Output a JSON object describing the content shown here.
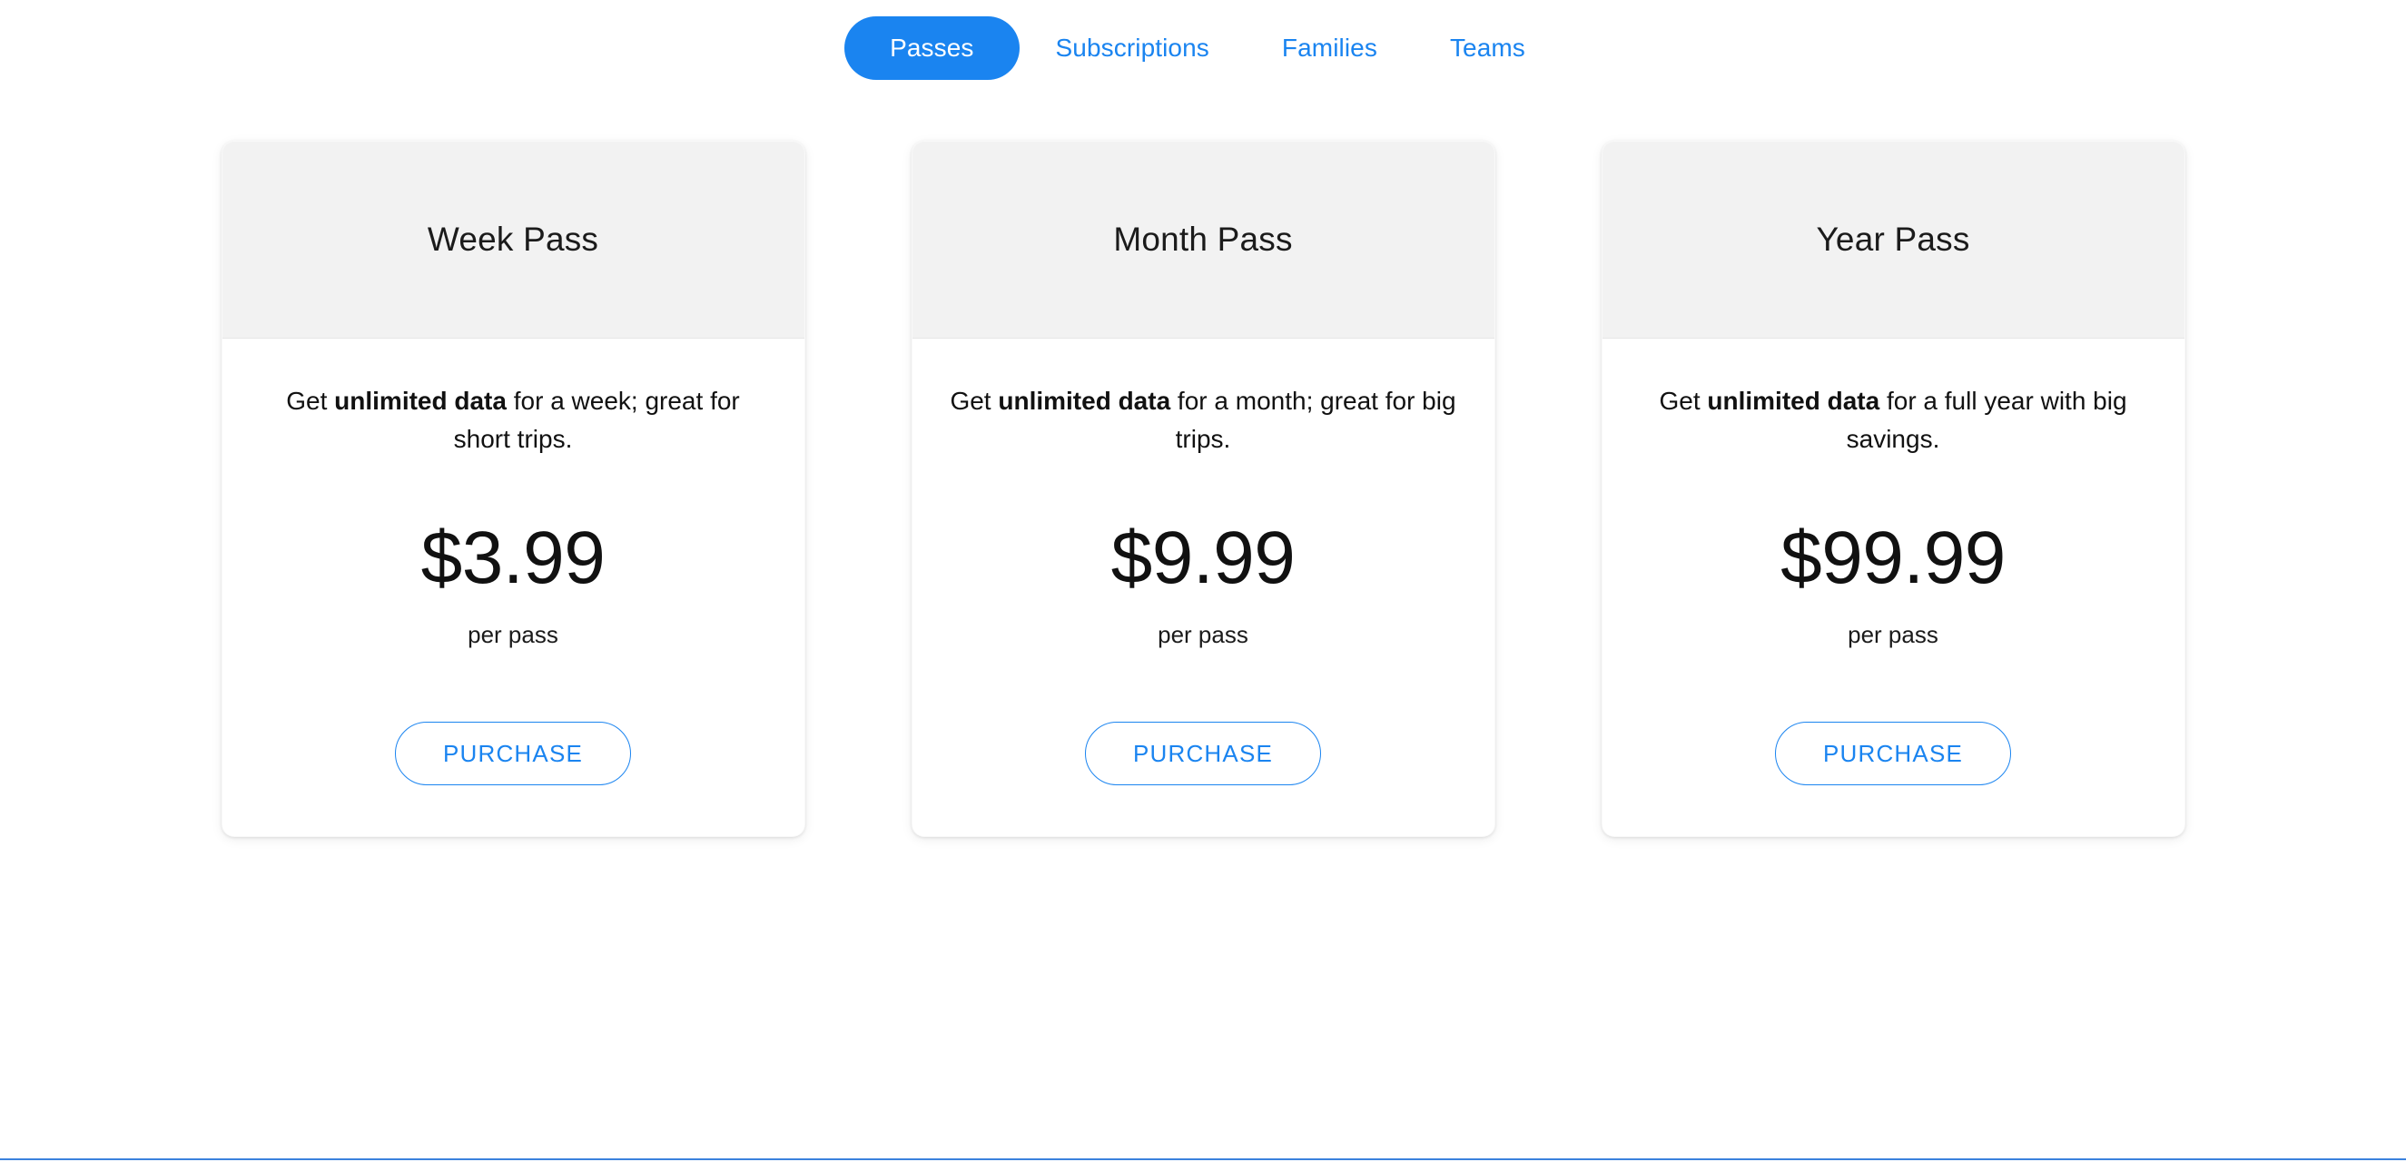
{
  "tabs": [
    {
      "label": "Passes",
      "active": true
    },
    {
      "label": "Subscriptions",
      "active": false
    },
    {
      "label": "Families",
      "active": false
    },
    {
      "label": "Teams",
      "active": false
    }
  ],
  "colors": {
    "accent": "#1a84f0",
    "footer_rule": "#3b82dd",
    "card_header_bg": "#f2f2f2",
    "card_bg": "#ffffff",
    "text": "#111111"
  },
  "cards": [
    {
      "title": "Week Pass",
      "desc_before": "Get ",
      "desc_bold": "unlimited data",
      "desc_after": " for a week; great for short trips.",
      "price": "$3.99",
      "unit": "per pass",
      "button": "PURCHASE"
    },
    {
      "title": "Month Pass",
      "desc_before": "Get ",
      "desc_bold": "unlimited data",
      "desc_after": " for a month; great for big trips.",
      "price": "$9.99",
      "unit": "per pass",
      "button": "PURCHASE"
    },
    {
      "title": "Year Pass",
      "desc_before": "Get ",
      "desc_bold": "unlimited data",
      "desc_after": " for a full year with big savings.",
      "price": "$99.99",
      "unit": "per pass",
      "button": "PURCHASE"
    }
  ]
}
